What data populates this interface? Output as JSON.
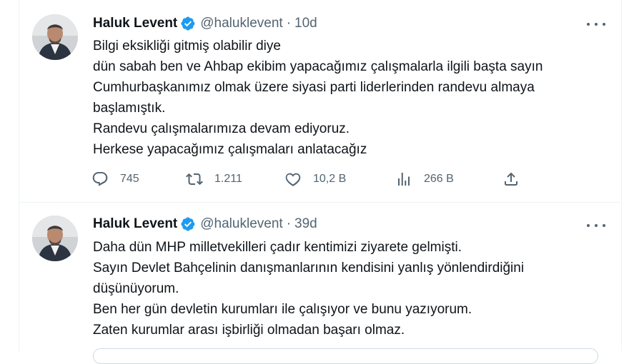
{
  "tweets": [
    {
      "author": {
        "name": "Haluk Levent",
        "handle": "@haluklevent",
        "verified": true
      },
      "time": "10d",
      "lines": [
        "Bilgi eksikliği gitmiş olabilir diye",
        "dün sabah ben ve Ahbap ekibim yapacağımız çalışmalarla ilgili başta sayın",
        "Cumhurbaşkanımız olmak üzere siyasi parti liderlerinden randevu almaya",
        "başlamıştık.",
        "Randevu çalışmalarımıza devam ediyoruz.",
        "Herkese yapacağımız çalışmaları anlatacağız"
      ],
      "stats": {
        "replies": "745",
        "retweets": "1.211",
        "likes": "10,2 B",
        "views": "266 B"
      }
    },
    {
      "author": {
        "name": "Haluk Levent",
        "handle": "@haluklevent",
        "verified": true
      },
      "time": "39d",
      "lines": [
        "Daha dün MHP milletvekilleri çadır kentimizi ziyarete gelmişti.",
        "Sayın Devlet Bahçelinin danışmanlarının kendisini yanlış yönlendirdiğini",
        "düşünüyorum.",
        "Ben her gün devletin kurumları ile çalışıyor ve bunu yazıyorum.",
        "Zaten kurumlar arası işbirliği olmadan başarı olmaz."
      ]
    }
  ],
  "separator": "·",
  "colors": {
    "verified": "#1d9bf0",
    "secondary_text": "#536471",
    "border": "#eff3f4"
  }
}
